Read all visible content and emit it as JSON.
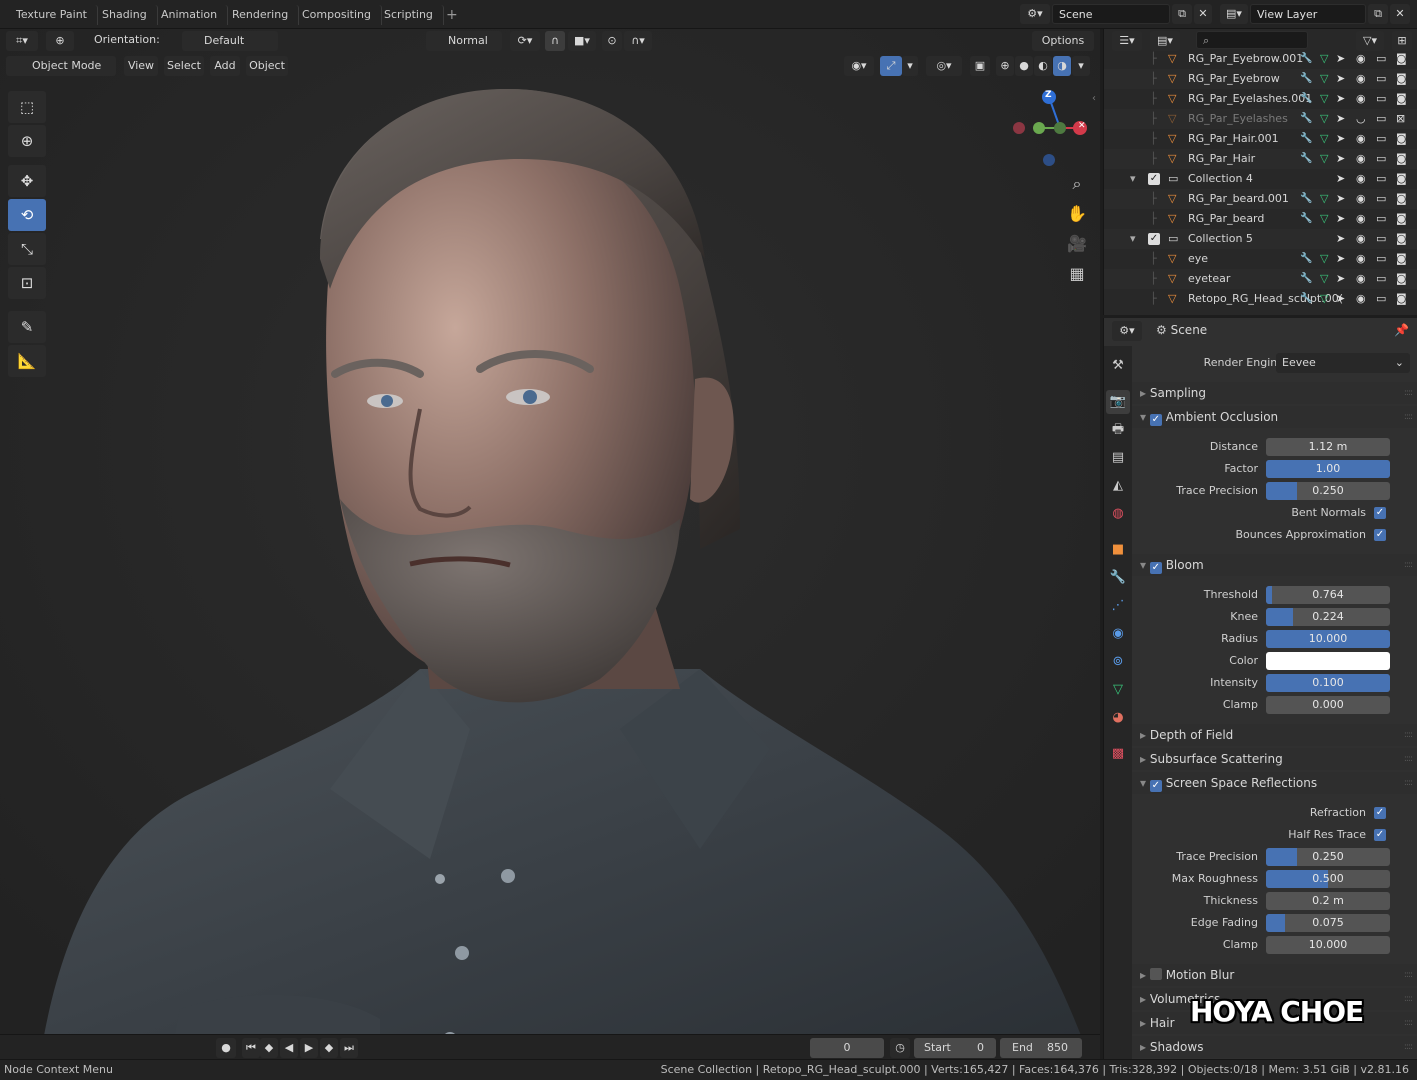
{
  "topbar": {
    "tabs": [
      "Texture Paint",
      "Shading",
      "Animation",
      "Rendering",
      "Compositing",
      "Scripting"
    ],
    "add_tab": "+",
    "scene": "Scene",
    "view_layer": "View Layer"
  },
  "viewport_header": {
    "orientation_label": "Orientation:",
    "orientation_value": "Default",
    "pivot": "Normal",
    "options": "Options",
    "mode": "Object Mode",
    "menus": [
      "View",
      "Select",
      "Add",
      "Object"
    ]
  },
  "gizmo": {
    "z": "Z"
  },
  "timeline": {
    "current_frame": "0",
    "start_label": "Start",
    "start_value": "0",
    "end_label": "End",
    "end_value": "850"
  },
  "status": {
    "left": "Node Context Menu",
    "right": "Scene Collection | Retopo_RG_Head_sculpt.000 | Verts:165,427 | Faces:164,376 | Tris:328,392 | Objects:0/18 | Mem: 3.51 GiB | v2.81.16"
  },
  "outliner": {
    "rows": [
      {
        "name": "RG_Par_Eyebrow.001",
        "type": "mesh",
        "indent": 1,
        "dim": false
      },
      {
        "name": "RG_Par_Eyebrow",
        "type": "mesh",
        "indent": 1,
        "dim": false
      },
      {
        "name": "RG_Par_Eyelashes.001",
        "type": "mesh",
        "indent": 1,
        "dim": false
      },
      {
        "name": "RG_Par_Eyelashes",
        "type": "mesh",
        "indent": 1,
        "dim": true
      },
      {
        "name": "RG_Par_Hair.001",
        "type": "mesh",
        "indent": 1,
        "dim": false
      },
      {
        "name": "RG_Par_Hair",
        "type": "mesh",
        "indent": 1,
        "dim": false
      },
      {
        "name": "Collection 4",
        "type": "collection",
        "indent": 0,
        "dim": false
      },
      {
        "name": "RG_Par_beard.001",
        "type": "mesh",
        "indent": 1,
        "dim": false
      },
      {
        "name": "RG_Par_beard",
        "type": "mesh",
        "indent": 1,
        "dim": false
      },
      {
        "name": "Collection 5",
        "type": "collection",
        "indent": 0,
        "dim": false
      },
      {
        "name": "eye",
        "type": "mesh",
        "indent": 1,
        "dim": false
      },
      {
        "name": "eyetear",
        "type": "mesh",
        "indent": 1,
        "dim": false
      },
      {
        "name": "Retopo_RG_Head_sculpt.00(",
        "type": "mesh",
        "indent": 1,
        "dim": false
      }
    ]
  },
  "properties": {
    "context": "Scene",
    "render_engine_label": "Render Engine",
    "render_engine_value": "Eevee",
    "sections": {
      "sampling": "Sampling",
      "ambient_occlusion": "Ambient Occlusion",
      "bloom": "Bloom",
      "depth_of_field": "Depth of Field",
      "subsurface": "Subsurface Scattering",
      "ssr": "Screen Space Reflections",
      "motion_blur": "Motion Blur",
      "volumetrics": "Volumetrics",
      "hair": "Hair",
      "shadows": "Shadows"
    },
    "ao": {
      "distance_label": "Distance",
      "distance": "1.12 m",
      "factor_label": "Factor",
      "factor": "1.00",
      "factor_fill": 1.0,
      "trace_label": "Trace Precision",
      "trace": "0.250",
      "trace_fill": 0.25,
      "bent_label": "Bent Normals",
      "bounces_label": "Bounces Approximation"
    },
    "bloom": {
      "threshold_label": "Threshold",
      "threshold": "0.764",
      "threshold_fill": 0.05,
      "knee_label": "Knee",
      "knee": "0.224",
      "knee_fill": 0.22,
      "radius_label": "Radius",
      "radius": "10.000",
      "radius_fill": 1.0,
      "color_label": "Color",
      "intensity_label": "Intensity",
      "intensity": "0.100",
      "intensity_fill": 1.0,
      "clamp_label": "Clamp",
      "clamp": "0.000",
      "clamp_fill": 0.0
    },
    "ssr": {
      "refraction_label": "Refraction",
      "halfres_label": "Half Res Trace",
      "trace_label": "Trace Precision",
      "trace": "0.250",
      "trace_fill": 0.25,
      "roughness_label": "Max Roughness",
      "roughness": "0.500",
      "roughness_fill": 0.5,
      "thickness_label": "Thickness",
      "thickness": "0.2 m",
      "edge_label": "Edge Fading",
      "edge": "0.075",
      "edge_fill": 0.15,
      "clamp_label": "Clamp",
      "clamp": "10.000"
    }
  },
  "watermark": "HOYA CHOE",
  "colors": {
    "accent": "#4772b3",
    "mesh_icon": "#f0903c",
    "bg": "#303030"
  }
}
